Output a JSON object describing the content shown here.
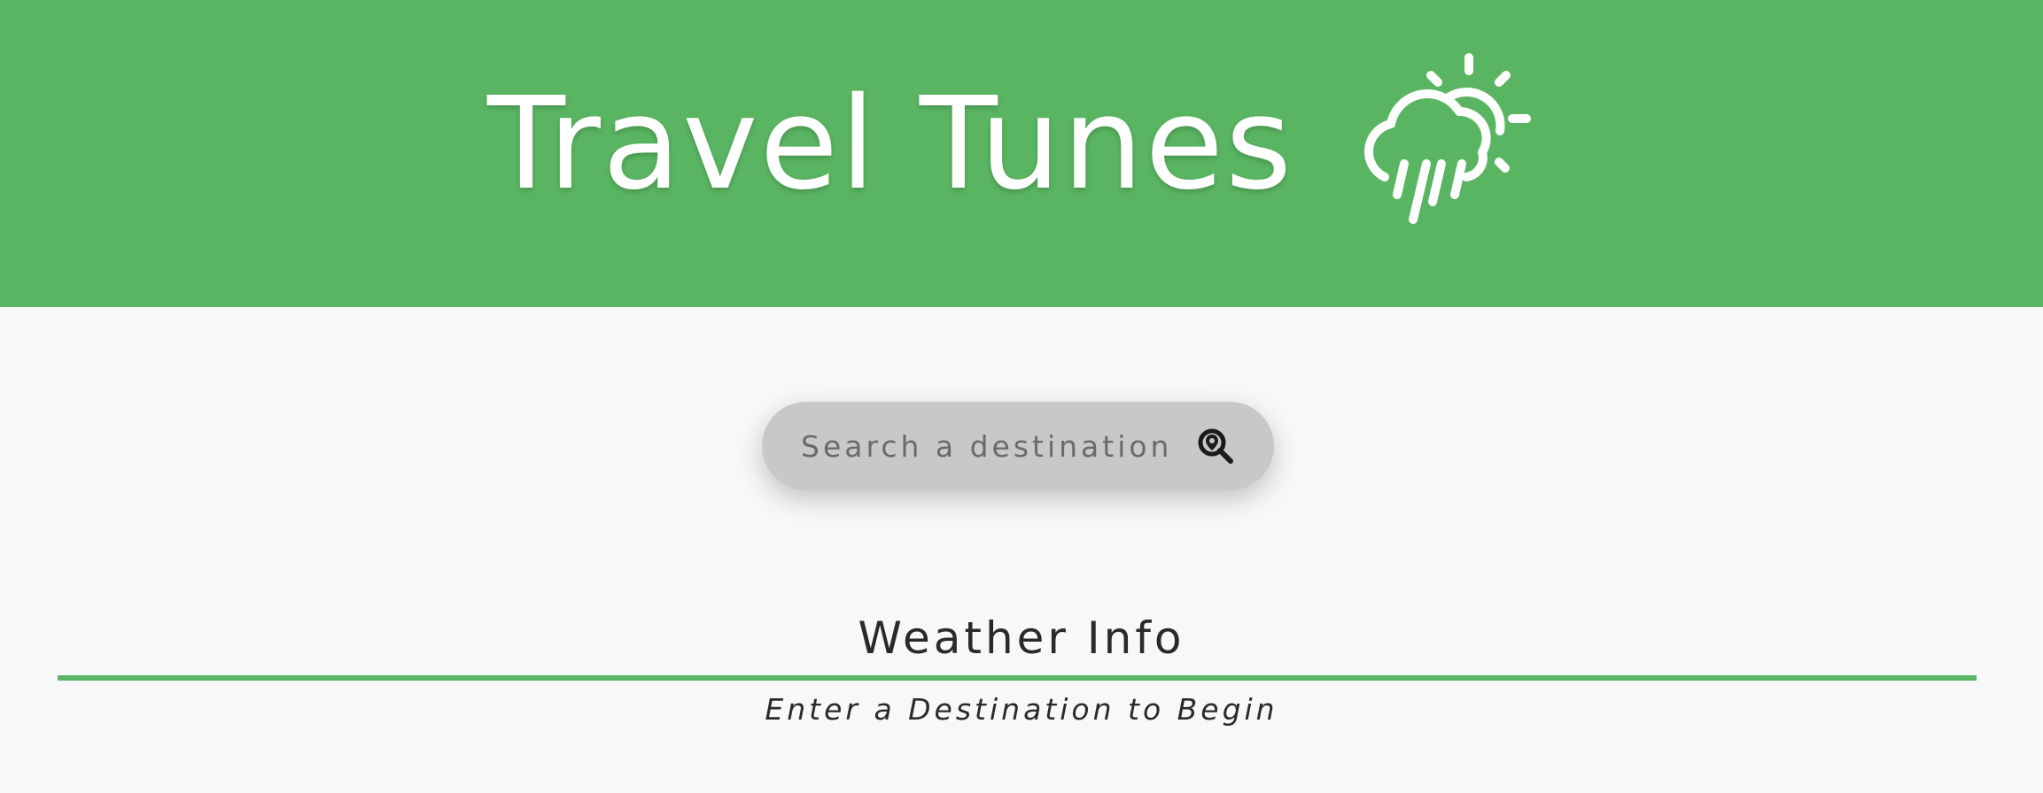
{
  "header": {
    "title": "Travel Tunes",
    "icon": "weather-cloud-sun-rain-icon",
    "background_color": "#59b561"
  },
  "search": {
    "placeholder": "Search a destination",
    "value": "",
    "button_icon": "location-search-icon"
  },
  "weather": {
    "heading": "Weather Info",
    "prompt": "Enter a Destination to Begin"
  },
  "colors": {
    "accent": "#59b561",
    "page_background": "#f7f8fa",
    "search_background": "#c8c9c7"
  }
}
